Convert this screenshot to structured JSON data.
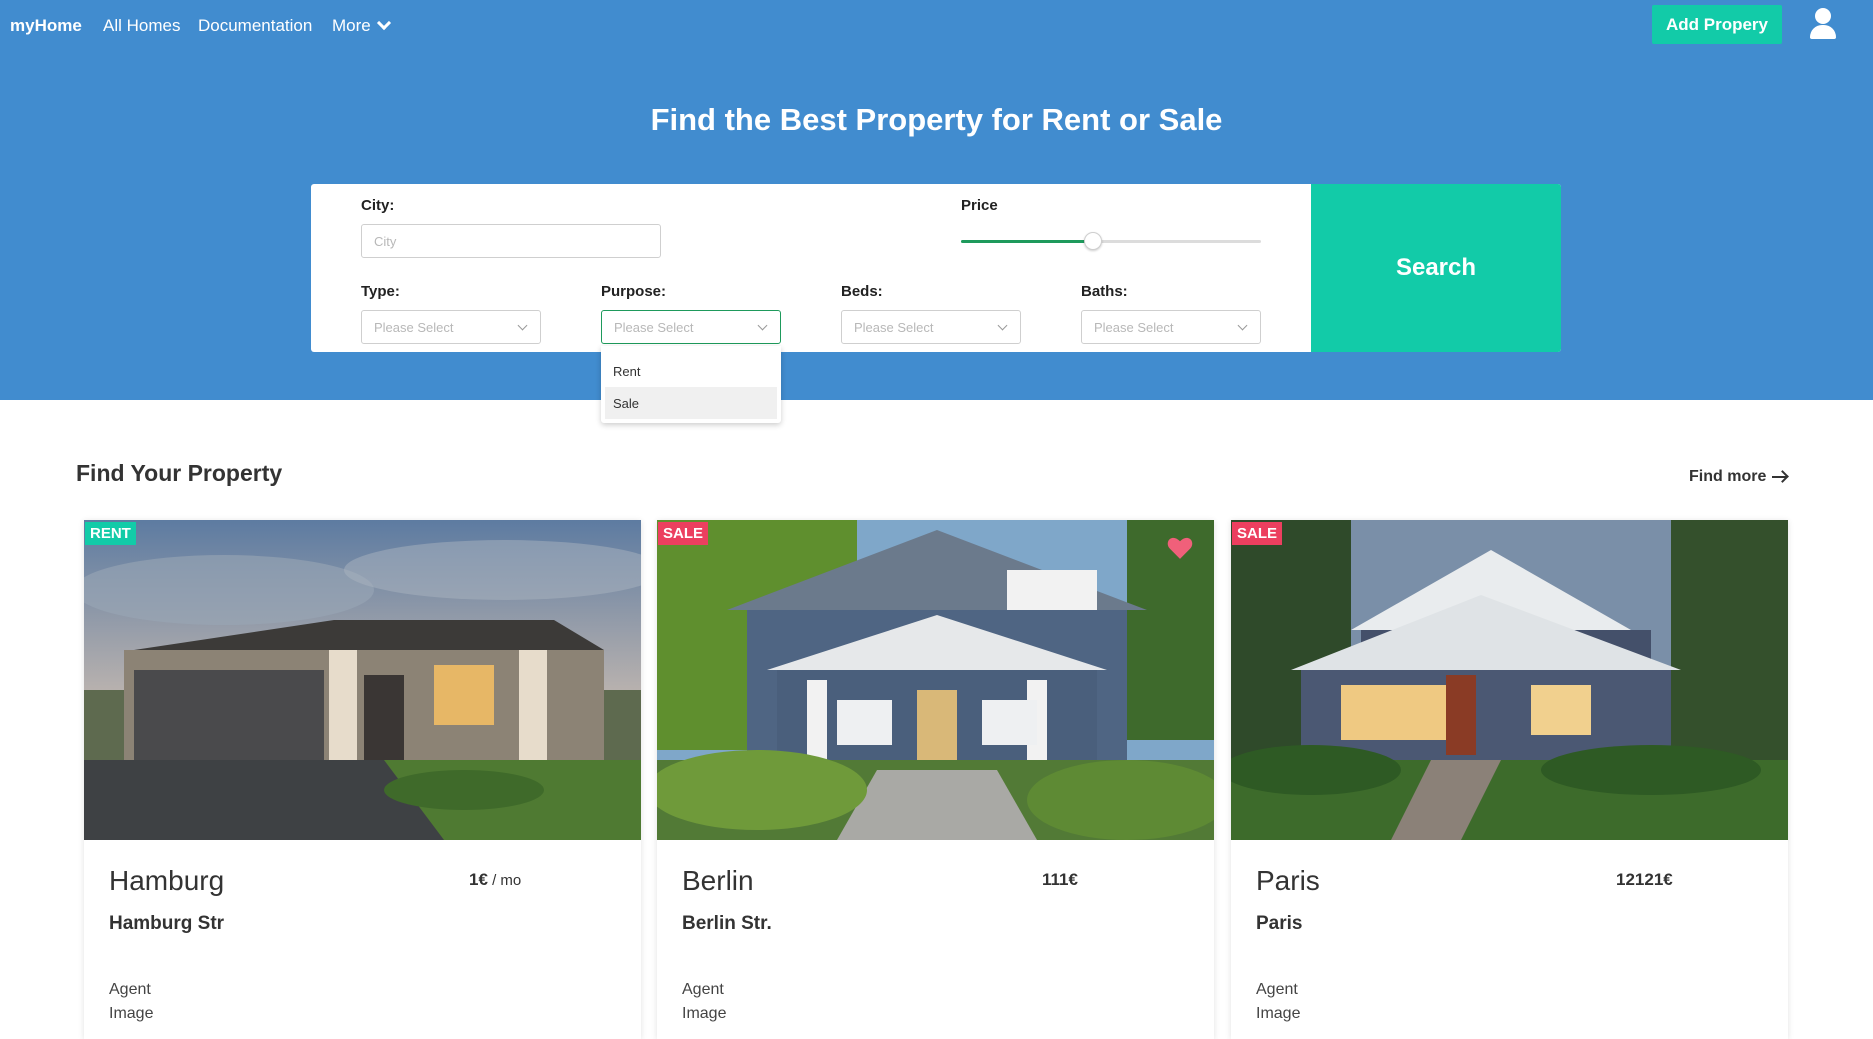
{
  "nav": {
    "brand": "myHome",
    "links": [
      "All Homes",
      "Documentation"
    ],
    "more": "More",
    "add_button": "Add Propery"
  },
  "hero": {
    "title": "Find the Best Property for Rent or Sale"
  },
  "search": {
    "city_label": "City:",
    "city_placeholder": "City",
    "price_label": "Price",
    "price_level": 0.44,
    "type_label": "Type:",
    "purpose_label": "Purpose:",
    "beds_label": "Beds:",
    "baths_label": "Baths:",
    "select_placeholder": "Please Select",
    "purpose_options": [
      "Rent",
      "Sale"
    ],
    "button": "Search"
  },
  "section": {
    "title": "Find Your Property",
    "find_more": "Find more"
  },
  "listings": [
    {
      "badge": "RENT",
      "city": "Hamburg",
      "price": "1€",
      "period": " / mo",
      "street": "Hamburg Str",
      "agent": "Agent",
      "image_label": "Image"
    },
    {
      "badge": "SALE",
      "city": "Berlin",
      "price": "111€",
      "period": "",
      "street": "Berlin Str.",
      "agent": "Agent",
      "image_label": "Image"
    },
    {
      "badge": "SALE",
      "city": "Paris",
      "price": "12121€",
      "period": "",
      "street": "Paris",
      "agent": "Agent",
      "image_label": "Image"
    }
  ],
  "colors": {
    "hero": "#418ccf",
    "accent": "#12cba8",
    "sale": "#ec3f5f",
    "slider": "#1e9a5c"
  }
}
